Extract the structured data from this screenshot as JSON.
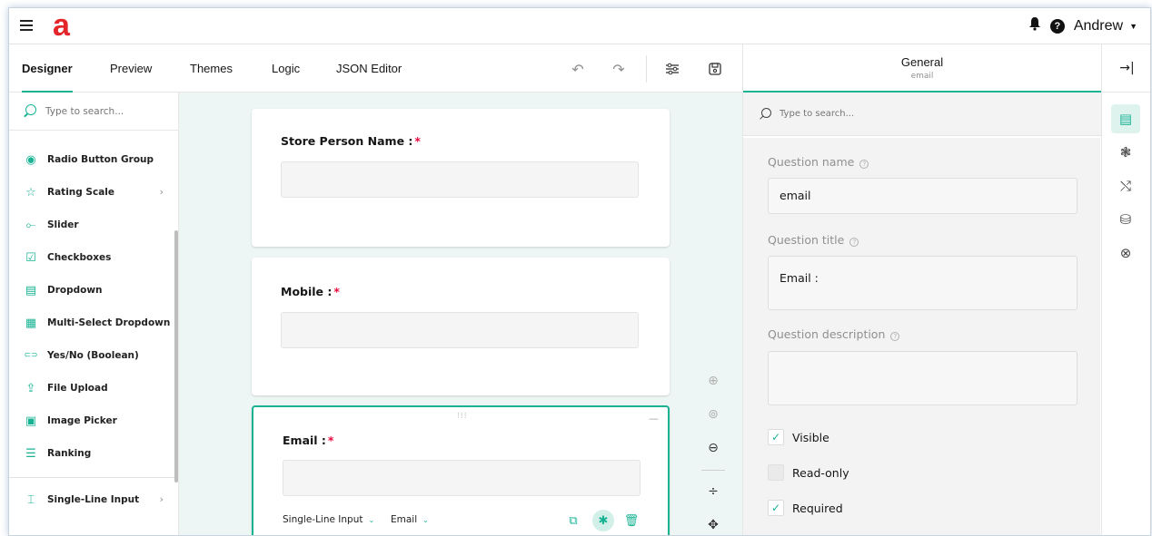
{
  "app": {
    "logo": "a",
    "user_name": "Andrew"
  },
  "designer_tabs": [
    {
      "label": "Designer",
      "active": true
    },
    {
      "label": "Preview"
    },
    {
      "label": "Themes"
    },
    {
      "label": "Logic"
    },
    {
      "label": "JSON Editor"
    }
  ],
  "toolbar_icons": [
    "undo-icon",
    "redo-icon",
    "settings-icon",
    "save-icon"
  ],
  "toolbox": {
    "search_placeholder": "Type to search...",
    "items": [
      {
        "label": "Radio Button Group",
        "icon": "◉"
      },
      {
        "label": "Rating Scale",
        "icon": "☆",
        "has_submenu": true
      },
      {
        "label": "Slider",
        "icon": "⟜"
      },
      {
        "label": "Checkboxes",
        "icon": "☑"
      },
      {
        "label": "Dropdown",
        "icon": "▤"
      },
      {
        "label": "Multi-Select Dropdown",
        "icon": "▦"
      },
      {
        "label": "Yes/No (Boolean)",
        "icon": "⊂⊃"
      },
      {
        "label": "File Upload",
        "icon": "⇪"
      },
      {
        "label": "Image Picker",
        "icon": "▣"
      },
      {
        "label": "Ranking",
        "icon": "☰"
      }
    ],
    "after_divider": [
      {
        "label": "Single-Line Input",
        "icon": "⌶",
        "has_submenu": true
      }
    ]
  },
  "questions": [
    {
      "title": "Store Person Name :",
      "required_mark": "*"
    },
    {
      "title": "Mobile :",
      "required_mark": "*"
    },
    {
      "title": "Email :",
      "required_mark": "*",
      "selected": true,
      "type_dropdown": "Single-Line Input",
      "input_type_dropdown": "Email"
    }
  ],
  "property_panel": {
    "category": "General",
    "subtitle": "email",
    "search_placeholder": "Type to search...",
    "question_name_label": "Question name",
    "question_name_value": "email",
    "question_title_label": "Question title",
    "question_title_value": "Email :",
    "question_description_label": "Question description",
    "question_description_value": "",
    "checks": [
      {
        "label": "Visible",
        "checked": true
      },
      {
        "label": "Read-only",
        "checked": false
      },
      {
        "label": "Required",
        "checked": true
      }
    ]
  },
  "colors": {
    "accent": "#19b394",
    "required": "#e60a3e",
    "logo": "#e4252a",
    "canvas_bg": "#edf6f4"
  }
}
